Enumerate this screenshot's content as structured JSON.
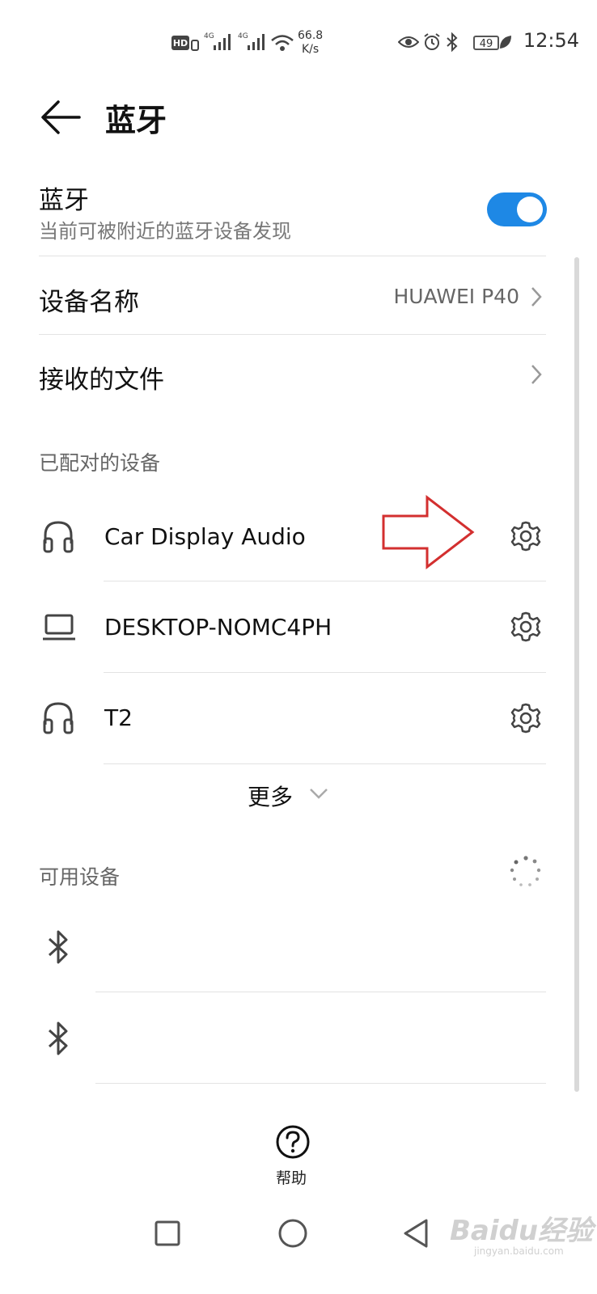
{
  "status_bar": {
    "network_speed_value": "66.8",
    "network_speed_unit": "K/s",
    "battery": "49",
    "time": "12:54",
    "hd_label": "HD",
    "signal1_label": "4G",
    "signal2_label": "4G"
  },
  "header": {
    "title": "蓝牙"
  },
  "bluetooth_toggle": {
    "label": "蓝牙",
    "subtitle": "当前可被附近的蓝牙设备发现",
    "enabled": true,
    "accent_color": "#1e88e5"
  },
  "device_name": {
    "label": "设备名称",
    "value": "HUAWEI P40"
  },
  "received_files": {
    "label": "接收的文件"
  },
  "paired_section": {
    "title": "已配对的设备",
    "devices": [
      {
        "name": "Car Display Audio",
        "icon": "headset-icon"
      },
      {
        "name": "DESKTOP-NOMC4PH",
        "icon": "laptop-icon"
      },
      {
        "name": "T2",
        "icon": "headset-icon"
      }
    ],
    "more_label": "更多"
  },
  "available_section": {
    "title": "可用设备",
    "devices": [
      {
        "icon": "bluetooth-icon"
      },
      {
        "icon": "bluetooth-icon"
      }
    ]
  },
  "help": {
    "label": "帮助",
    "icon": "question-icon"
  },
  "watermark": {
    "text": "Baidu经验",
    "sub": "jingyan.baidu.com"
  },
  "annotation": {
    "arrow_color": "#d32f2f"
  }
}
